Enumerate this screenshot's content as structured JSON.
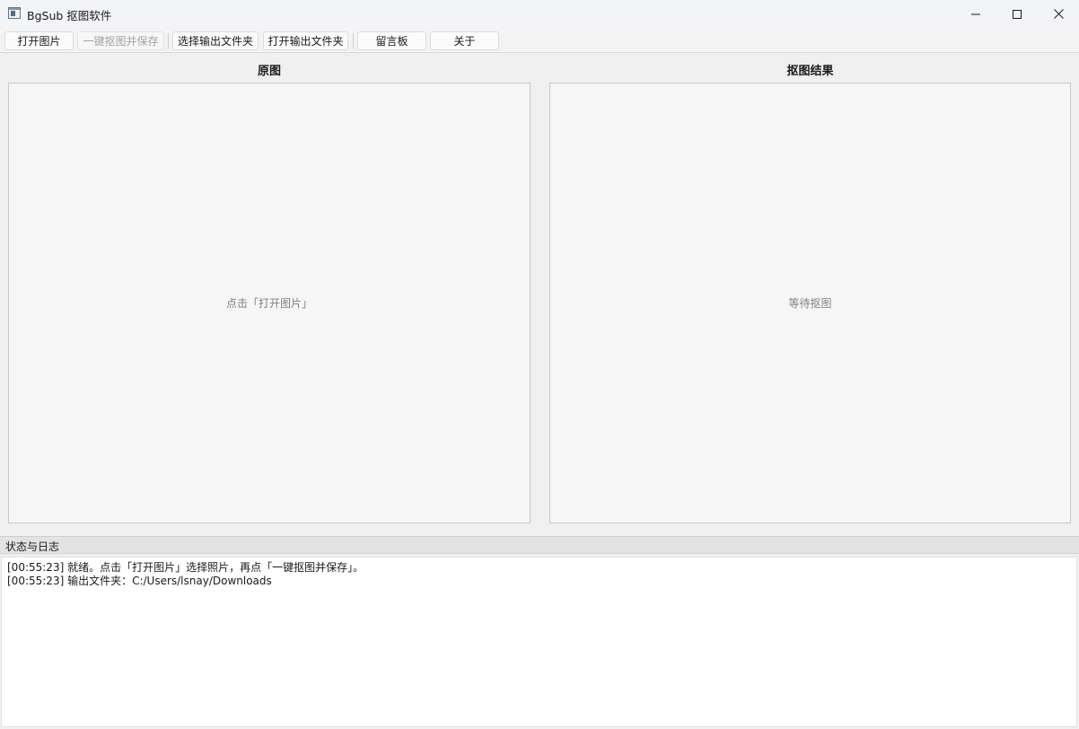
{
  "window": {
    "title": "BgSub 抠图软件",
    "icon": "app-window-icon"
  },
  "toolbar": {
    "buttons": [
      {
        "label": "打开图片",
        "enabled": true
      },
      {
        "label": "一键抠图并保存",
        "enabled": false
      },
      {
        "label": "选择输出文件夹",
        "enabled": true
      },
      {
        "label": "打开输出文件夹",
        "enabled": true
      },
      {
        "label": "留言板",
        "enabled": true
      },
      {
        "label": "关于",
        "enabled": true
      }
    ]
  },
  "panels": {
    "original": {
      "title": "原图",
      "hint": "点击「打开图片」"
    },
    "result": {
      "title": "抠图结果",
      "hint": "等待抠图"
    }
  },
  "log": {
    "header": "状态与日志",
    "lines": [
      "[00:55:23] 就绪。点击「打开图片」选择照片，再点「一键抠图并保存」。",
      "[00:55:23] 输出文件夹：C:/Users/lsnay/Downloads"
    ]
  },
  "colors": {
    "background": "#f0f0f0",
    "panel_bg": "#f6f6f6",
    "panel_border": "#c9c9c9",
    "log_bg": "#ffffff",
    "disabled_text": "#a3a3a3"
  }
}
